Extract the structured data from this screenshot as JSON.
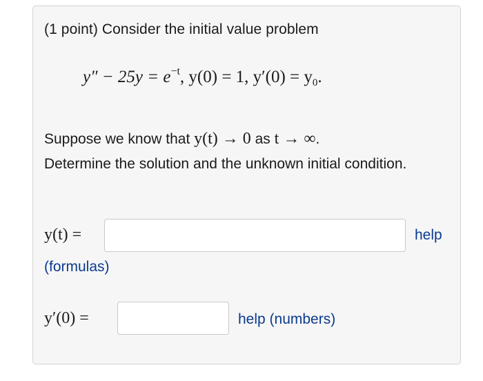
{
  "problem": {
    "intro": "(1 point) Consider the initial value problem",
    "equation": {
      "lhs": "y″ − 25y = e",
      "exp": "−t",
      "ic1": ",   y(0) = 1,   y′(0) = y",
      "ic2_sub": "0",
      "end": "."
    },
    "para": {
      "t1": "Suppose we know that ",
      "m1": "y(t) → 0",
      "t2": " as ",
      "m2": "t → ∞",
      "t3": ".",
      "line2": "Determine the solution and the unknown initial condition."
    }
  },
  "answer_yt": {
    "label": "y(t) =",
    "value": "",
    "help": "help",
    "formulas": "(formulas)"
  },
  "answer_yp0": {
    "label": "y′(0) =",
    "value": "",
    "help": "help (numbers)"
  },
  "colors": {
    "link": "#0b3a8f",
    "card_bg": "#f6f6f6"
  }
}
